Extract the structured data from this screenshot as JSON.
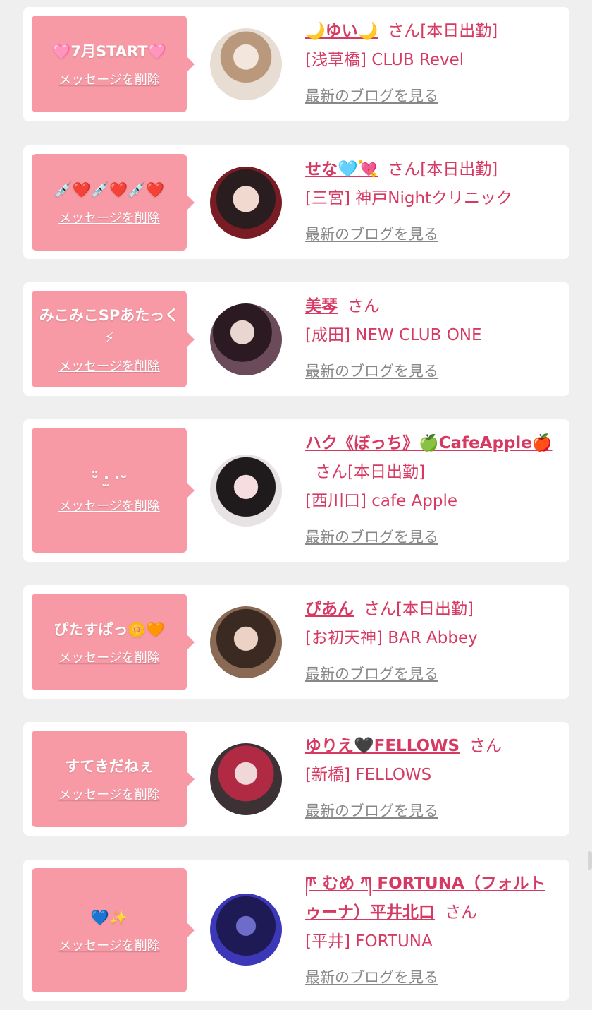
{
  "ui": {
    "delete_label": "メッセージを削除",
    "blog_label": "最新のブログを見る",
    "san_suffix": "さん"
  },
  "colors": {
    "page_bg": "#efefef",
    "card_bg": "#ffffff",
    "bubble_bg": "#f89aa6",
    "name_color": "#d63a63",
    "blog_link_color": "#888888"
  },
  "items": [
    {
      "message": "🩷7月START🩷",
      "name": "🌙ゆい🌙",
      "status": "[本日出勤]",
      "shop": "[浅草橋] CLUB Revel"
    },
    {
      "message": "💉❤️💉❤️💉❤️",
      "name": "せな🩵💘",
      "status": "[本日出勤]",
      "shop": "[三宮] 神戸Nightクリニック"
    },
    {
      "message": "みこみこSPあたっく⚡",
      "name": "美琴",
      "status": "",
      "shop": "[成田] NEW CLUB ONE"
    },
    {
      "message": "ᵕ̈ ·̫ ·ᵕ",
      "name": "ハク《ぼっち》🍏CafeApple🍎",
      "status": "[本日出勤]",
      "shop": "[西川口] cafe Apple"
    },
    {
      "message": "ぴたすぱっ🌼🧡",
      "name": "ぴあん",
      "status": "[本日出勤]",
      "shop": "[お初天神] BAR Abbey"
    },
    {
      "message": "すてきだねぇ",
      "name": "ゆりえ🖤FELLOWS",
      "status": "",
      "shop": "[新橋] FELLOWS"
    },
    {
      "message": "💙✨",
      "name": "ཫ むめ ཀ FORTUNA（フォルトゥーナ）平井北口",
      "status": "",
      "shop": "[平井] FORTUNA"
    }
  ]
}
